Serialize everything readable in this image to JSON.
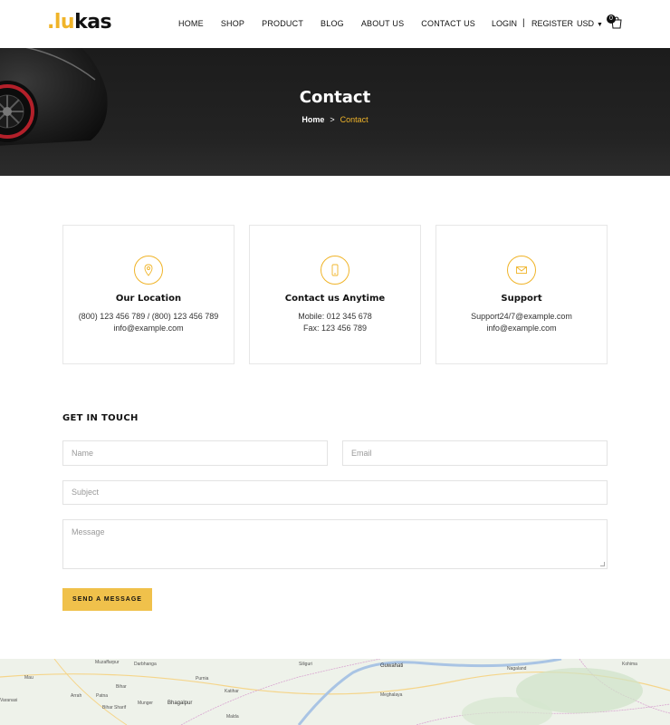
{
  "brand": {
    "prefix": ".",
    "accent": "lu",
    "rest": "kas"
  },
  "nav": [
    "HOME",
    "SHOP",
    "PRODUCT",
    "BLOG",
    "ABOUT US",
    "CONTACT US"
  ],
  "header": {
    "login": "LOGIN",
    "separator": "|",
    "register": "REGISTER",
    "currency": "USD",
    "cart_count": "0"
  },
  "hero": {
    "title": "Contact",
    "breadcrumb_home": "Home",
    "breadcrumb_arrow": ">",
    "breadcrumb_current": "Contact"
  },
  "info": [
    {
      "icon": "location-pin-icon",
      "title": "Our Location",
      "line1": "(800) 123 456 789 / (800) 123 456 789",
      "line2": "info@example.com"
    },
    {
      "icon": "mobile-phone-icon",
      "title": "Contact us Anytime",
      "line1": "Mobile: 012 345 678",
      "line2": "Fax: 123 456 789"
    },
    {
      "icon": "envelope-icon",
      "title": "Support",
      "line1": "Support24/7@example.com",
      "line2": "info@example.com"
    }
  ],
  "form": {
    "title": "GET IN TOUCH",
    "name_placeholder": "Name",
    "email_placeholder": "Email",
    "subject_placeholder": "Subject",
    "message_placeholder": "Message",
    "send_label": "SEND A MESSAGE"
  },
  "map": {
    "labels": [
      "Muzaffarpur",
      "Darbhanga",
      "Mau",
      "Bihar",
      "Purnia",
      "Guwahati",
      "Nagaland",
      "Arrah",
      "Patna",
      "Katihar",
      "Meghalaya",
      "Bihar Sharif",
      "Munger",
      "Bhagalpur",
      "Malda",
      "Siliguri",
      "Kohima",
      "Varanasi"
    ]
  },
  "colors": {
    "accent": "#f0b429",
    "button": "#f0c14b",
    "hero_bg": "#1c1c1c"
  }
}
